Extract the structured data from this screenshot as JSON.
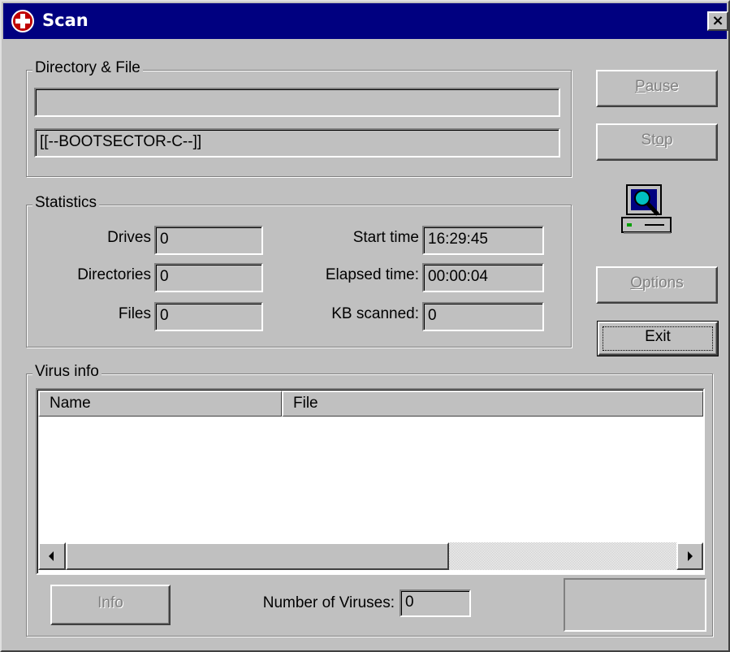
{
  "window": {
    "title": "Scan",
    "close_glyph": "×",
    "app_icon": "medical-cross-icon"
  },
  "directory_file": {
    "legend": "Directory & File",
    "directory_value": "",
    "file_value": "[[--BOOTSECTOR-C--]]"
  },
  "statistics": {
    "legend": "Statistics",
    "drives_label": "Drives",
    "drives_value": "0",
    "directories_label": "Directories",
    "directories_value": "0",
    "files_label": "Files",
    "files_value": "0",
    "start_time_label": "Start time",
    "start_time_value": "16:29:45",
    "elapsed_label": "Elapsed time:",
    "elapsed_value": "00:00:04",
    "kb_label": "KB scanned:",
    "kb_value": "0"
  },
  "buttons": {
    "pause_mnemonic": "P",
    "pause_rest": "ause",
    "stop_pre": "St",
    "stop_mnemonic": "o",
    "stop_rest": "p",
    "options_mnemonic": "O",
    "options_rest": "ptions",
    "exit_label": "Exit",
    "info_label": "Info"
  },
  "scan_icon": "computer-magnifier-icon",
  "virus_info": {
    "legend": "Virus info",
    "columns": [
      "Name",
      "File"
    ],
    "rows": [],
    "number_label": "Number of Viruses:",
    "number_value": "0"
  },
  "colors": {
    "face": "#c0c0c0",
    "title_bar": "#000080",
    "disabled_text": "#808080"
  }
}
